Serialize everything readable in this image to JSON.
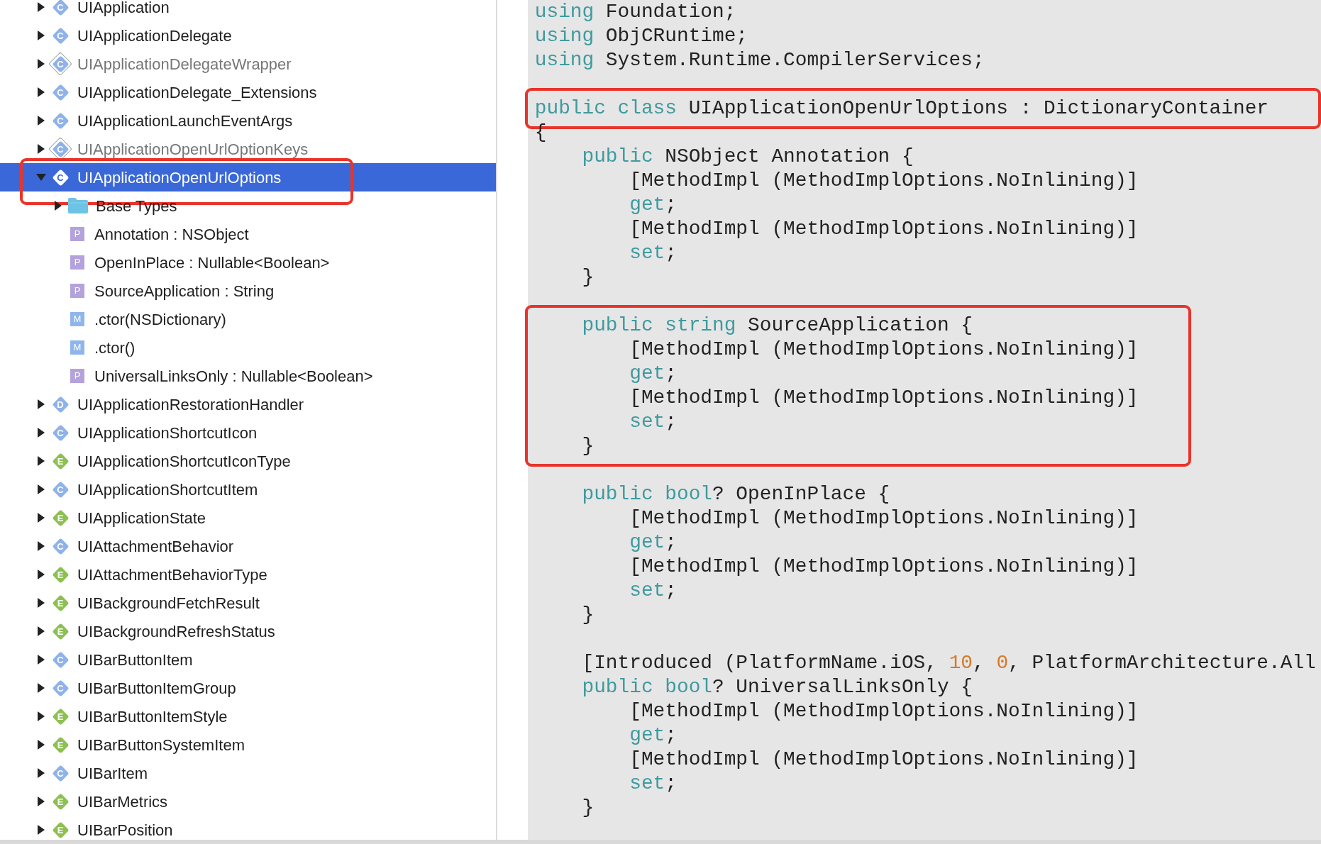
{
  "tree": {
    "items": [
      {
        "label": "UIApplication",
        "badge": "C",
        "kind": "class",
        "expanded": false,
        "selected": false,
        "dimmed": false,
        "boxed": false
      },
      {
        "label": "UIApplicationDelegate",
        "badge": "C",
        "kind": "class",
        "expanded": false,
        "selected": false,
        "dimmed": false,
        "boxed": false
      },
      {
        "label": "UIApplicationDelegateWrapper",
        "badge": "C",
        "kind": "class",
        "expanded": false,
        "selected": false,
        "dimmed": true,
        "boxed": false
      },
      {
        "label": "UIApplicationDelegate_Extensions",
        "badge": "C",
        "kind": "class",
        "expanded": false,
        "selected": false,
        "dimmed": false,
        "boxed": false
      },
      {
        "label": "UIApplicationLaunchEventArgs",
        "badge": "C",
        "kind": "class",
        "expanded": false,
        "selected": false,
        "dimmed": false,
        "boxed": false
      },
      {
        "label": "UIApplicationOpenUrlOptionKeys",
        "badge": "C",
        "kind": "class",
        "expanded": false,
        "selected": false,
        "dimmed": true,
        "boxed": false
      },
      {
        "label": "UIApplicationOpenUrlOptions",
        "badge": "C",
        "kind": "class",
        "expanded": true,
        "selected": true,
        "dimmed": false,
        "boxed": true,
        "children": [
          {
            "label": "Base Types",
            "kind": "folder",
            "expanded": false,
            "selected": false
          },
          {
            "label": "Annotation : NSObject",
            "badge": "P",
            "kind": "member",
            "selected": false
          },
          {
            "label": "OpenInPlace : Nullable<Boolean>",
            "badge": "P",
            "kind": "member",
            "selected": false
          },
          {
            "label": "SourceApplication : String",
            "badge": "P",
            "kind": "member",
            "selected": false
          },
          {
            "label": ".ctor(NSDictionary)",
            "badge": "M",
            "kind": "method",
            "selected": false
          },
          {
            "label": ".ctor()",
            "badge": "M",
            "kind": "method",
            "selected": false
          },
          {
            "label": "UniversalLinksOnly : Nullable<Boolean>",
            "badge": "P",
            "kind": "member",
            "selected": false
          }
        ]
      },
      {
        "label": "UIApplicationRestorationHandler",
        "badge": "D",
        "kind": "class",
        "expanded": false,
        "selected": false,
        "dimmed": false,
        "boxed": false
      },
      {
        "label": "UIApplicationShortcutIcon",
        "badge": "C",
        "kind": "class",
        "expanded": false,
        "selected": false,
        "dimmed": false,
        "boxed": false
      },
      {
        "label": "UIApplicationShortcutIconType",
        "badge": "E",
        "kind": "enum",
        "expanded": false,
        "selected": false,
        "dimmed": false,
        "boxed": false
      },
      {
        "label": "UIApplicationShortcutItem",
        "badge": "C",
        "kind": "class",
        "expanded": false,
        "selected": false,
        "dimmed": false,
        "boxed": false
      },
      {
        "label": "UIApplicationState",
        "badge": "E",
        "kind": "enum",
        "expanded": false,
        "selected": false,
        "dimmed": false,
        "boxed": false
      },
      {
        "label": "UIAttachmentBehavior",
        "badge": "C",
        "kind": "class",
        "expanded": false,
        "selected": false,
        "dimmed": false,
        "boxed": false
      },
      {
        "label": "UIAttachmentBehaviorType",
        "badge": "E",
        "kind": "enum",
        "expanded": false,
        "selected": false,
        "dimmed": false,
        "boxed": false
      },
      {
        "label": "UIBackgroundFetchResult",
        "badge": "E",
        "kind": "enum",
        "expanded": false,
        "selected": false,
        "dimmed": false,
        "boxed": false
      },
      {
        "label": "UIBackgroundRefreshStatus",
        "badge": "E",
        "kind": "enum",
        "expanded": false,
        "selected": false,
        "dimmed": false,
        "boxed": false
      },
      {
        "label": "UIBarButtonItem",
        "badge": "C",
        "kind": "class",
        "expanded": false,
        "selected": false,
        "dimmed": false,
        "boxed": false
      },
      {
        "label": "UIBarButtonItemGroup",
        "badge": "C",
        "kind": "class",
        "expanded": false,
        "selected": false,
        "dimmed": false,
        "boxed": false
      },
      {
        "label": "UIBarButtonItemStyle",
        "badge": "E",
        "kind": "enum",
        "expanded": false,
        "selected": false,
        "dimmed": false,
        "boxed": false
      },
      {
        "label": "UIBarButtonSystemItem",
        "badge": "E",
        "kind": "enum",
        "expanded": false,
        "selected": false,
        "dimmed": false,
        "boxed": false
      },
      {
        "label": "UIBarItem",
        "badge": "C",
        "kind": "class",
        "expanded": false,
        "selected": false,
        "dimmed": false,
        "boxed": false
      },
      {
        "label": "UIBarMetrics",
        "badge": "E",
        "kind": "enum",
        "expanded": false,
        "selected": false,
        "dimmed": false,
        "boxed": false
      },
      {
        "label": "UIBarPosition",
        "badge": "E",
        "kind": "enum",
        "expanded": false,
        "selected": false,
        "dimmed": false,
        "boxed": false
      }
    ]
  },
  "code": {
    "blocks": [
      {
        "boxed": false,
        "lines": [
          {
            "kind": "code",
            "segments": [
              {
                "text": "using",
                "kind": "keyword"
              },
              {
                "text": " Foundation;",
                "kind": "plain"
              }
            ]
          },
          {
            "kind": "code",
            "segments": [
              {
                "text": "using",
                "kind": "keyword"
              },
              {
                "text": " ObjCRuntime;",
                "kind": "plain"
              }
            ]
          },
          {
            "kind": "code",
            "segments": [
              {
                "text": "using",
                "kind": "keyword"
              },
              {
                "text": " System.Runtime.CompilerServices;",
                "kind": "plain"
              }
            ]
          },
          {
            "kind": "blank"
          }
        ]
      },
      {
        "boxed": true,
        "lines": [
          {
            "kind": "code",
            "segments": [
              {
                "text": "public class",
                "kind": "keyword"
              },
              {
                "text": " UIApplicationOpenUrlOptions : DictionaryContainer",
                "kind": "plain"
              }
            ]
          }
        ]
      },
      {
        "boxed": false,
        "lines": [
          {
            "kind": "code",
            "segments": [
              {
                "text": "{",
                "kind": "plain"
              }
            ]
          },
          {
            "kind": "code",
            "segments": [
              {
                "text": "    public",
                "kind": "keyword"
              },
              {
                "text": " NSObject Annotation {",
                "kind": "plain"
              }
            ]
          },
          {
            "kind": "code",
            "segments": [
              {
                "text": "        [MethodImpl (MethodImplOptions.NoInlining)]",
                "kind": "plain"
              }
            ]
          },
          {
            "kind": "code",
            "segments": [
              {
                "text": "        get",
                "kind": "keyword"
              },
              {
                "text": ";",
                "kind": "plain"
              }
            ]
          },
          {
            "kind": "code",
            "segments": [
              {
                "text": "        [MethodImpl (MethodImplOptions.NoInlining)]",
                "kind": "plain"
              }
            ]
          },
          {
            "kind": "code",
            "segments": [
              {
                "text": "        set",
                "kind": "keyword"
              },
              {
                "text": ";",
                "kind": "plain"
              }
            ]
          },
          {
            "kind": "code",
            "segments": [
              {
                "text": "    }",
                "kind": "plain"
              }
            ]
          },
          {
            "kind": "blank"
          }
        ]
      },
      {
        "boxed": true,
        "lines": [
          {
            "kind": "code",
            "segments": [
              {
                "text": "    public string",
                "kind": "keyword"
              },
              {
                "text": " SourceApplication {",
                "kind": "plain"
              }
            ]
          },
          {
            "kind": "code",
            "segments": [
              {
                "text": "        [MethodImpl (MethodImplOptions.NoInlining)]",
                "kind": "plain"
              }
            ]
          },
          {
            "kind": "code",
            "segments": [
              {
                "text": "        get",
                "kind": "keyword"
              },
              {
                "text": ";",
                "kind": "plain"
              }
            ]
          },
          {
            "kind": "code",
            "segments": [
              {
                "text": "        [MethodImpl (MethodImplOptions.NoInlining)]",
                "kind": "plain"
              }
            ]
          },
          {
            "kind": "code",
            "segments": [
              {
                "text": "        set",
                "kind": "keyword"
              },
              {
                "text": ";",
                "kind": "plain"
              }
            ]
          },
          {
            "kind": "code",
            "segments": [
              {
                "text": "    }",
                "kind": "plain"
              }
            ]
          }
        ]
      },
      {
        "boxed": false,
        "lines": [
          {
            "kind": "blank"
          },
          {
            "kind": "code",
            "segments": [
              {
                "text": "    public bool",
                "kind": "keyword"
              },
              {
                "text": "? OpenInPlace {",
                "kind": "plain"
              }
            ]
          },
          {
            "kind": "code",
            "segments": [
              {
                "text": "        [MethodImpl (MethodImplOptions.NoInlining)]",
                "kind": "plain"
              }
            ]
          },
          {
            "kind": "code",
            "segments": [
              {
                "text": "        get",
                "kind": "keyword"
              },
              {
                "text": ";",
                "kind": "plain"
              }
            ]
          },
          {
            "kind": "code",
            "segments": [
              {
                "text": "        [MethodImpl (MethodImplOptions.NoInlining)]",
                "kind": "plain"
              }
            ]
          },
          {
            "kind": "code",
            "segments": [
              {
                "text": "        set",
                "kind": "keyword"
              },
              {
                "text": ";",
                "kind": "plain"
              }
            ]
          },
          {
            "kind": "code",
            "segments": [
              {
                "text": "    }",
                "kind": "plain"
              }
            ]
          },
          {
            "kind": "blank"
          },
          {
            "kind": "code",
            "segments": [
              {
                "text": "    [Introduced (PlatformName.iOS, ",
                "kind": "plain"
              },
              {
                "text": "10",
                "kind": "number"
              },
              {
                "text": ", ",
                "kind": "plain"
              },
              {
                "text": "0",
                "kind": "number"
              },
              {
                "text": ", PlatformArchitecture.All",
                "kind": "plain"
              }
            ]
          },
          {
            "kind": "code",
            "segments": [
              {
                "text": "    public bool",
                "kind": "keyword"
              },
              {
                "text": "? UniversalLinksOnly {",
                "kind": "plain"
              }
            ]
          },
          {
            "kind": "code",
            "segments": [
              {
                "text": "        [MethodImpl (MethodImplOptions.NoInlining)]",
                "kind": "plain"
              }
            ]
          },
          {
            "kind": "code",
            "segments": [
              {
                "text": "        get",
                "kind": "keyword"
              },
              {
                "text": ";",
                "kind": "plain"
              }
            ]
          },
          {
            "kind": "code",
            "segments": [
              {
                "text": "        [MethodImpl (MethodImplOptions.NoInlining)]",
                "kind": "plain"
              }
            ]
          },
          {
            "kind": "code",
            "segments": [
              {
                "text": "        set",
                "kind": "keyword"
              },
              {
                "text": ";",
                "kind": "plain"
              }
            ]
          },
          {
            "kind": "code",
            "segments": [
              {
                "text": "    }",
                "kind": "plain"
              }
            ]
          }
        ]
      }
    ]
  }
}
